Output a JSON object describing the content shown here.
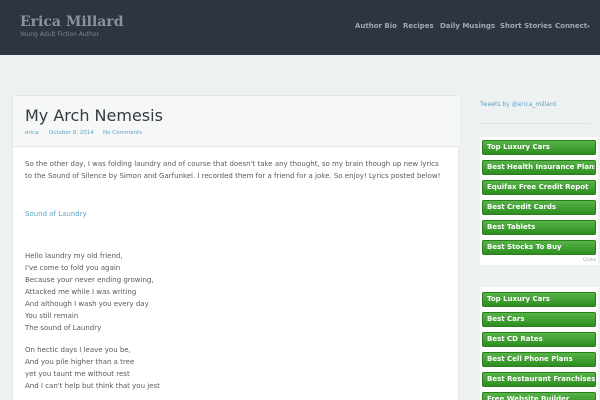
{
  "header": {
    "site_title": "Erica Millard",
    "site_description": "Young Adult Fiction Author",
    "nav": [
      "Author Bio",
      "Recipes",
      "Daily Musings",
      "Short Stories",
      "Connect"
    ],
    "nav_dropdown_icon": "chevron-down-icon"
  },
  "post": {
    "title": "My Arch Nemesis",
    "author": "erica",
    "date": "October 8, 2014",
    "comments": "No Comments",
    "intro": "So the other day, I was folding laundry and of course that doesn't take any thought, so my brain though up new lyrics to the Sound of Silence by Simon and Garfunkel. I recorded them for a friend for a joke. So enjoy! Lyrics posted below!",
    "link": "Sound of Laundry",
    "stanza1": [
      "Hello laundry my old friend,",
      "I've come to fold you again",
      "Because your never ending growing,",
      "Attacked me while I was writing",
      "And although I wash you every day",
      "You still remain",
      "The sound of Laundry"
    ],
    "stanza2": [
      "On hectic days I leave you be,",
      "And you pile higher than a tree",
      "yet you taunt me without rest",
      "And I can't help but think that you jest"
    ]
  },
  "sidebar": {
    "tweets_label": "Tweets by @erica_millard",
    "ads1": [
      "Top Luxury Cars",
      "Best Health Insurance Plans",
      "Equifax Free Credit Repot",
      "Best Credit Cards",
      "Best Tablets",
      "Best Stocks To Buy"
    ],
    "ads1_footer": "Clicks",
    "ads2": [
      "Top Luxury Cars",
      "Best Cars",
      "Best CD Rates",
      "Best Cell Phone Plans",
      "Best Restaurant Franchises",
      "Free Website Builder"
    ],
    "colors": {
      "ad_green": "#3fa12f",
      "link": "#5fa4c6",
      "header_bg": "#2d3541"
    }
  }
}
